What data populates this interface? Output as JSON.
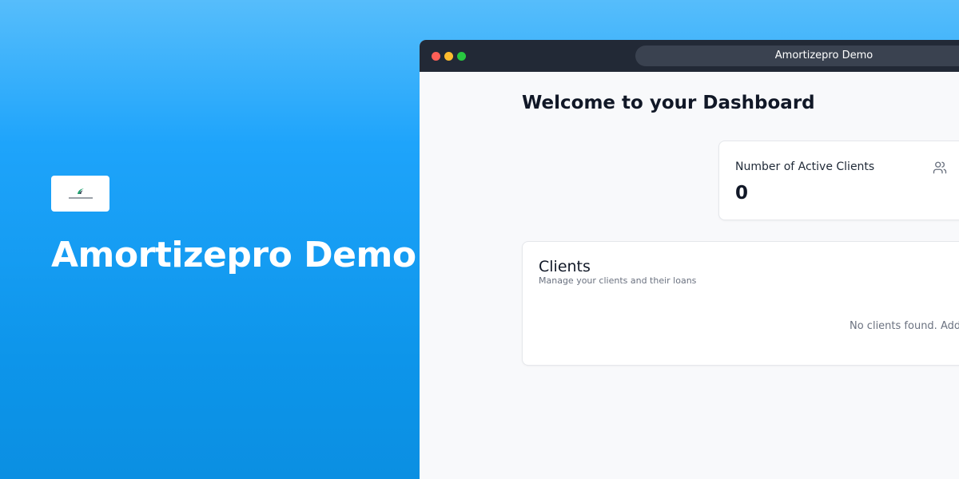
{
  "hero": {
    "title": "Amortizepro Demo",
    "logo_text": "AMORTIZEPRO"
  },
  "window": {
    "url_title": "Amortizepro Demo"
  },
  "dashboard": {
    "title": "Welcome to your Dashboard",
    "stat_card": {
      "label": "Number of Active Clients",
      "value": "0",
      "icon": "users-icon"
    },
    "clients": {
      "title": "Clients",
      "subtitle": "Manage your clients and their loans",
      "empty_message": "No clients found. Add y"
    }
  },
  "colors": {
    "hero_gradient_top": "#56bdfb",
    "hero_gradient_bottom": "#0b8fe2",
    "titlebar": "#222936",
    "traffic_red": "#ff5f57",
    "traffic_yellow": "#febc2e",
    "traffic_green": "#28c840",
    "logo_green": "#1aa06d"
  }
}
